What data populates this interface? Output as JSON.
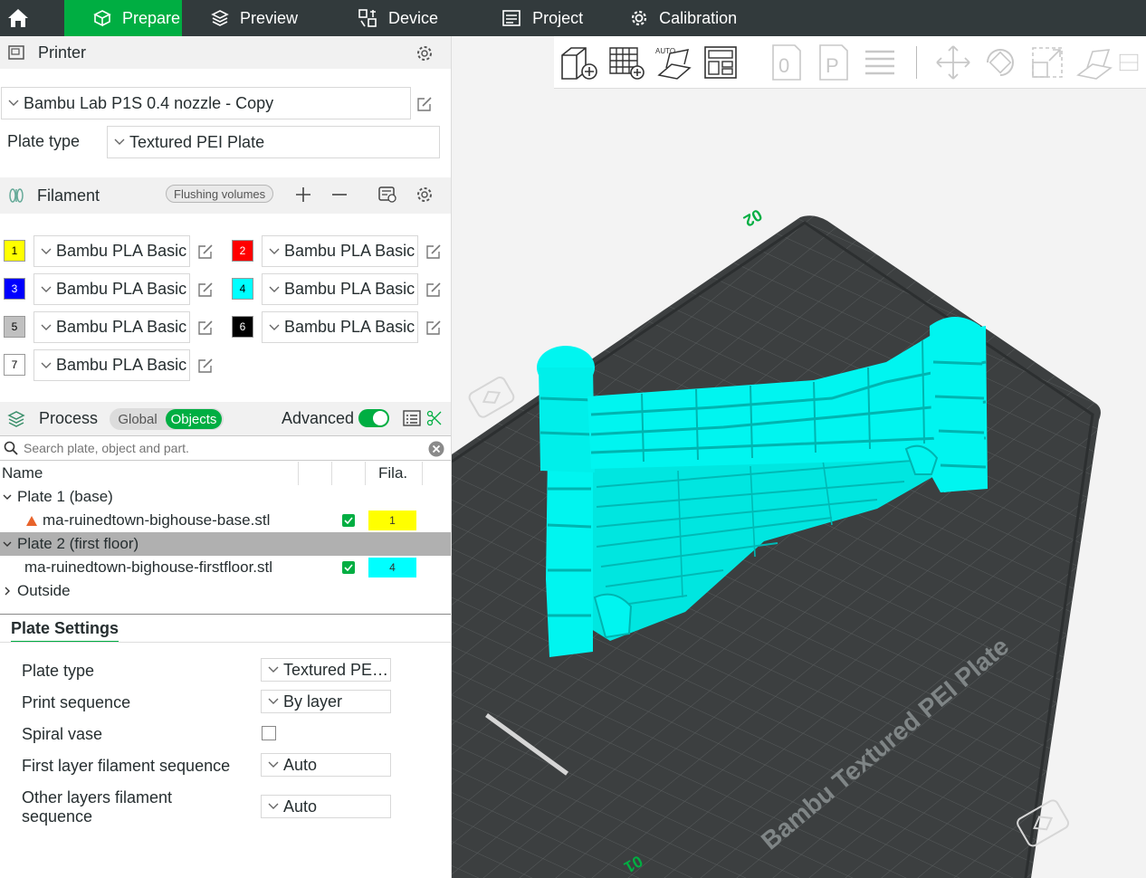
{
  "nav": {
    "tabs": [
      {
        "label": "Prepare",
        "icon": "cube-icon",
        "active": true
      },
      {
        "label": "Preview",
        "icon": "layers-icon",
        "active": false
      },
      {
        "label": "Device",
        "icon": "device-icon",
        "active": false
      },
      {
        "label": "Project",
        "icon": "project-icon",
        "active": false
      },
      {
        "label": "Calibration",
        "icon": "calibration-icon",
        "active": false
      }
    ]
  },
  "printer": {
    "title": "Printer",
    "preset": "Bambu Lab P1S 0.4 nozzle - Copy",
    "plate_type_label": "Plate type",
    "plate_type": "Textured PEI Plate"
  },
  "filament": {
    "title": "Filament",
    "flushing_label": "Flushing volumes",
    "items": [
      {
        "num": "1",
        "color": "#ffff00",
        "text_color": "#000000",
        "name": "Bambu PLA Basic"
      },
      {
        "num": "2",
        "color": "#ff0000",
        "text_color": "#ffffff",
        "name": "Bambu PLA Basic"
      },
      {
        "num": "3",
        "color": "#0000ff",
        "text_color": "#ffffff",
        "name": "Bambu PLA Basic"
      },
      {
        "num": "4",
        "color": "#00ffff",
        "text_color": "#000000",
        "name": "Bambu PLA Basic"
      },
      {
        "num": "5",
        "color": "#c0c0c0",
        "text_color": "#000000",
        "name": "Bambu PLA Basic"
      },
      {
        "num": "6",
        "color": "#000000",
        "text_color": "#ffffff",
        "name": "Bambu PLA Basic"
      },
      {
        "num": "7",
        "color": "#ffffff",
        "text_color": "#000000",
        "name": "Bambu PLA Basic"
      }
    ]
  },
  "process": {
    "title": "Process",
    "tab_global": "Global",
    "tab_objects": "Objects",
    "advanced_label": "Advanced",
    "search_placeholder": "Search plate, object and part."
  },
  "object_list": {
    "col_name": "Name",
    "col_fila": "Fila.",
    "rows": [
      {
        "label": "Plate 1 (base)",
        "type": "plate"
      },
      {
        "label": "ma-ruinedtown-bighouse-base.stl",
        "type": "object",
        "fila": "1",
        "fila_color": "#ffff00",
        "warning": true
      },
      {
        "label": "Plate 2 (first floor)",
        "type": "plate",
        "selected": true
      },
      {
        "label": "ma-ruinedtown-bighouse-firstfloor.stl",
        "type": "object",
        "fila": "4",
        "fila_color": "#00ffff"
      },
      {
        "label": "Outside",
        "type": "group"
      }
    ]
  },
  "plate_settings": {
    "tab": "Plate Settings",
    "plate_type_label": "Plate type",
    "plate_type_value": "Textured PEI...",
    "print_seq_label": "Print sequence",
    "print_seq_value": "By layer",
    "spiral_label": "Spiral vase",
    "first_layer_label": "First layer filament sequence",
    "first_layer_value": "Auto",
    "other_layers_label_1": "Other layers filament",
    "other_layers_label_2": "sequence",
    "other_layers_value": "Auto"
  },
  "viewport": {
    "plate_label": "Bambu Textured PEI Plate",
    "plate_number": "02",
    "plate_number_2": "01",
    "model_color": "#00f5f0",
    "bed_color": "#3c3f40"
  }
}
